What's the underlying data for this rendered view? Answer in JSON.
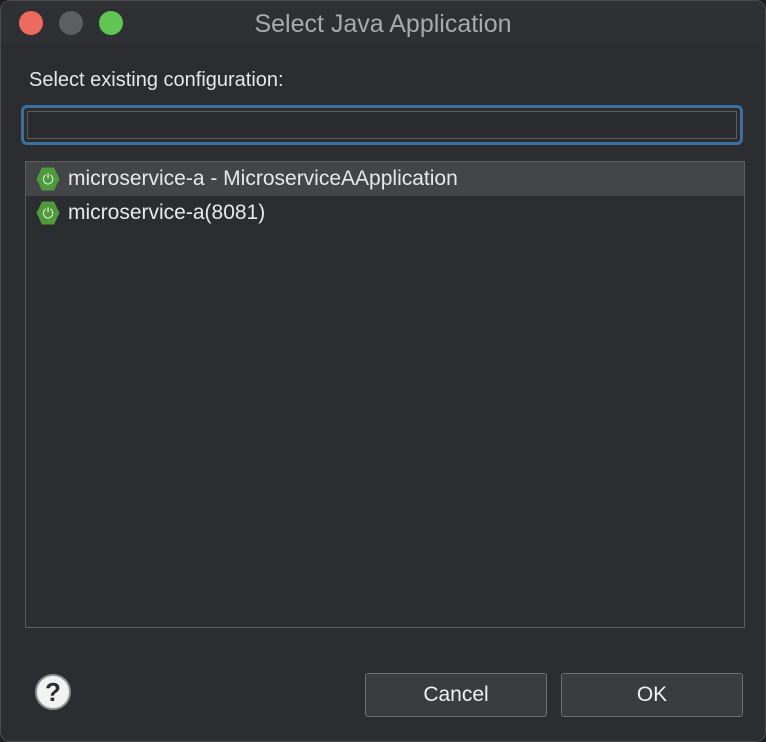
{
  "window": {
    "title": "Select Java Application"
  },
  "dialog": {
    "prompt": "Select existing configuration:",
    "filter": {
      "value": "",
      "placeholder": ""
    },
    "items": [
      {
        "label": "microservice-a - MicroserviceAApplication",
        "icon": "spring-boot-icon",
        "selected": true
      },
      {
        "label": "microservice-a(8081)",
        "icon": "spring-boot-icon",
        "selected": false
      }
    ]
  },
  "buttons": {
    "help_glyph": "?",
    "cancel": "Cancel",
    "ok": "OK"
  },
  "colors": {
    "window_bg": "#2b2d30",
    "focus_ring": "#3f6f9d",
    "selection": "#434549",
    "spring_green": "#4f9a3a",
    "close": "#ed6a5e",
    "zoom": "#61c554"
  }
}
